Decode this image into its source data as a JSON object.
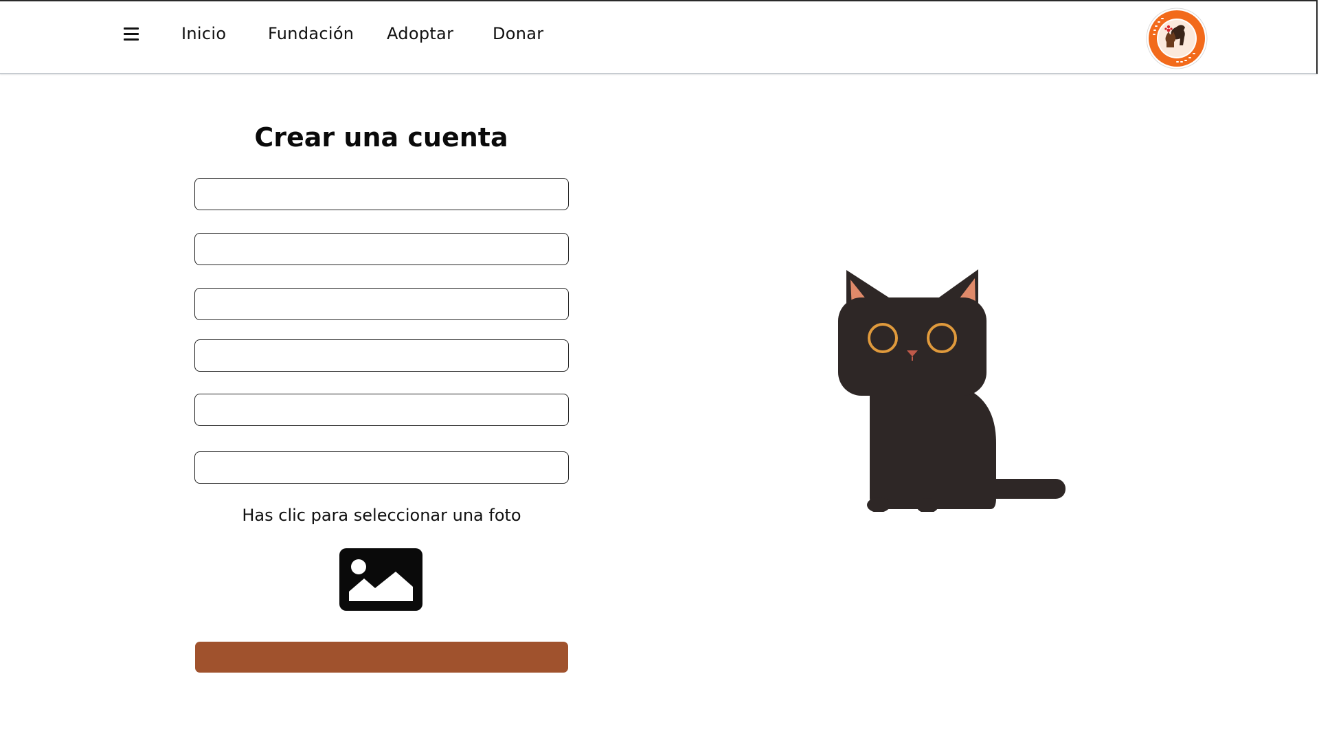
{
  "nav": {
    "menu_icon": "hamburger-menu-icon",
    "links": [
      "Inicio",
      "Fundación",
      "Adoptar",
      "Donar"
    ],
    "logo_icon": "foundation-logo"
  },
  "form": {
    "title": "Crear una cuenta",
    "fields": [
      {
        "value": "",
        "placeholder": ""
      },
      {
        "value": "",
        "placeholder": ""
      },
      {
        "value": "",
        "placeholder": ""
      },
      {
        "value": "",
        "placeholder": ""
      },
      {
        "value": "",
        "placeholder": ""
      },
      {
        "value": "",
        "placeholder": ""
      }
    ],
    "photo_label": "Has clic para seleccionar una foto",
    "photo_icon": "image-icon",
    "submit_label": ""
  },
  "illustration": {
    "icon": "black-cat-illustration"
  },
  "colors": {
    "accent": "#a0522d",
    "cat_body": "#2e2726",
    "cat_ear_inner": "#e08a6a",
    "cat_eye": "#e09a3c",
    "logo_orange": "#f26a1b"
  }
}
